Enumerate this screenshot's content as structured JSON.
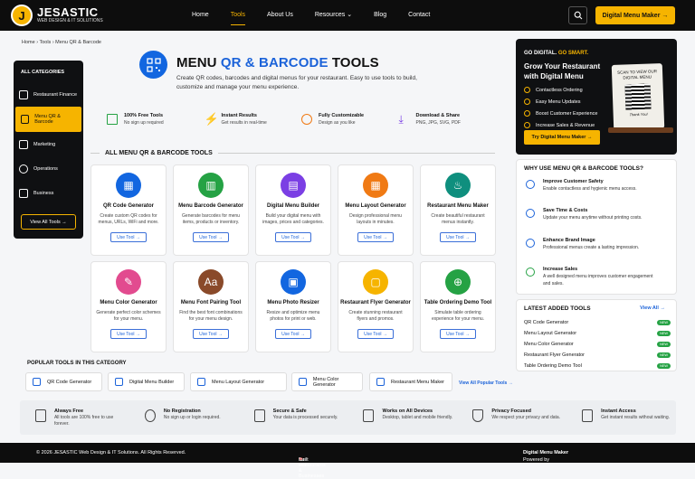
{
  "brand": {
    "name": "JESASTIC",
    "tagline": "WEB DESIGN & IT SOLUTIONS",
    "mark": "J"
  },
  "nav": {
    "items": [
      "Home",
      "Tools",
      "About Us",
      "Resources",
      "Blog",
      "Contact"
    ],
    "active": "Tools",
    "resources_chevron": "⌄",
    "cta": "Digital Menu Maker →"
  },
  "breadcrumb": "Home  ›  Tools  ›  Menu QR & Barcode",
  "categories": {
    "title": "ALL CATEGORIES",
    "items": [
      "Restaurant Finance",
      "Menu QR & Barcode",
      "Marketing",
      "Operations",
      "Business"
    ],
    "active": "Menu QR & Barcode",
    "view_all": "View All Tools  →"
  },
  "hero": {
    "title_a": "MENU ",
    "title_b": "QR & BARCODE",
    "title_c": " TOOLS",
    "description": "Create QR codes, barcodes and digital menus for your restaurant. Easy to use tools to build, customize and manage your menu experience."
  },
  "features": [
    {
      "title": "100% Free Tools",
      "sub": "No sign up required",
      "icon": "qr-icon"
    },
    {
      "title": "Instant Results",
      "sub": "Get results in real-time",
      "icon": "lightning-icon"
    },
    {
      "title": "Fully Customizable",
      "sub": "Design as you like",
      "icon": "palette-icon"
    },
    {
      "title": "Download & Share",
      "sub": "PNG, JPG, SVG, PDF",
      "icon": "download-icon"
    }
  ],
  "section_title": "ALL MENU QR & BARCODE TOOLS",
  "tools": [
    {
      "title": "QR Code Generator",
      "desc": "Create custom QR codes for menus, URLs, WiFi and more.",
      "color": "#1266e0",
      "glyph": "▦",
      "btn": "Use Tool  →"
    },
    {
      "title": "Menu Barcode Generator",
      "desc": "Generate barcodes for menu items, products or inventory.",
      "color": "#25a244",
      "glyph": "▥",
      "btn": "Use Tool  →"
    },
    {
      "title": "Digital Menu Builder",
      "desc": "Build your digital menu with images, prices and categories.",
      "color": "#7b3fe4",
      "glyph": "▤",
      "btn": "Use Tool  →"
    },
    {
      "title": "Menu Layout Generator",
      "desc": "Design professional menu layouts in minutes.",
      "color": "#f07a14",
      "glyph": "▦",
      "btn": "Use Tool  →"
    },
    {
      "title": "Restaurant Menu Maker",
      "desc": "Create beautiful restaurant menus instantly.",
      "color": "#0f8f7e",
      "glyph": "♨",
      "btn": "Use Tool  →"
    },
    {
      "title": "Menu Color Generator",
      "desc": "Generate perfect color schemes for your menu.",
      "color": "#e24b8f",
      "glyph": "✎",
      "btn": "Use Tool  →"
    },
    {
      "title": "Menu Font Pairing Tool",
      "desc": "Find the best font combinations for your menu design.",
      "color": "#8a4a2a",
      "glyph": "Aa",
      "btn": "Use Tool  →"
    },
    {
      "title": "Menu Photo Resizer",
      "desc": "Resize and optimize menu photos for print or web.",
      "color": "#1266e0",
      "glyph": "▣",
      "btn": "Use Tool  →"
    },
    {
      "title": "Restaurant Flyer Generator",
      "desc": "Create stunning restaurant flyers and promos.",
      "color": "#f6b400",
      "glyph": "▢",
      "btn": "Use Tool  →"
    },
    {
      "title": "Table Ordering Demo Tool",
      "desc": "Simulate table ordering experience for your menu.",
      "color": "#25a244",
      "glyph": "⊕",
      "btn": "Use Tool  →"
    }
  ],
  "popular": {
    "title": "POPULAR TOOLS IN THIS CATEGORY",
    "items": [
      "QR Code Generator",
      "Digital Menu Builder",
      "Menu Layout Generator",
      "Menu Color Generator",
      "Restaurant Menu Maker"
    ],
    "view_all": "View All Popular Tools  →"
  },
  "trust": [
    {
      "title": "Always Free",
      "sub": "All tools are 100% free to use forever."
    },
    {
      "title": "No Registration",
      "sub": "No sign up or login required."
    },
    {
      "title": "Secure & Safe",
      "sub": "Your data is processed securely."
    },
    {
      "title": "Works on All Devices",
      "sub": "Desktop, tablet and mobile friendly."
    },
    {
      "title": "Privacy Focused",
      "sub": "We respect your privacy and data."
    },
    {
      "title": "Instant Access",
      "sub": "Get instant results without waiting."
    }
  ],
  "promo": {
    "kicker_a": "GO DIGITAL. ",
    "kicker_b": "GO SMART.",
    "headline": "Grow Your Restaurant with Digital Menu",
    "points": [
      "Contactless Ordering",
      "Easy Menu Updates",
      "Boost Customer Experience",
      "Increase Sales & Revenue"
    ],
    "cta": "Try Digital Menu Maker  →",
    "stand_text": "SCAN TO VIEW OUR DIGITAL MENU",
    "stand_thanks": "Thank You!"
  },
  "why": {
    "title": "WHY USE MENU QR & BARCODE TOOLS?",
    "items": [
      {
        "title": "Improve Customer Safety",
        "desc": "Enable contactless and hygienic menu access."
      },
      {
        "title": "Save Time & Costs",
        "desc": "Update your menu anytime without printing costs."
      },
      {
        "title": "Enhance Brand Image",
        "desc": "Professional menus create a lasting impression."
      },
      {
        "title": "Increase Sales",
        "desc": "A well designed menu improves customer engagement and sales."
      }
    ]
  },
  "latest": {
    "title": "LATEST ADDED TOOLS",
    "view_all": "View All  →",
    "badge": "NEW",
    "items": [
      "QR Code Generator",
      "Menu Layout Generator",
      "Menu Color Generator",
      "Restaurant Flyer Generator",
      "Table Ordering Demo Tool"
    ]
  },
  "footer": {
    "copyright": "© 2026 JESASTIC Web Design & IT Solutions. All Rights Reserved.",
    "built_a": "Built with",
    "heart": "❤",
    "built_b": "for Restaurants & Businesses",
    "powered_a": "Powered by",
    "powered_b": "Digital Menu Maker"
  }
}
